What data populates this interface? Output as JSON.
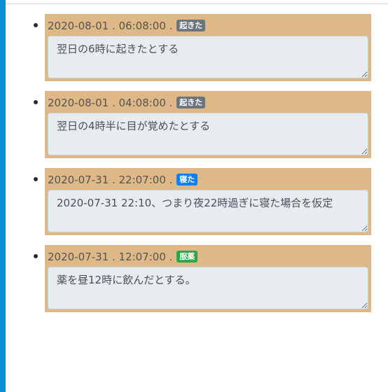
{
  "colors": {
    "frame": "#0a8fd6",
    "card_background": "#deb887"
  },
  "entries": [
    {
      "date": "2020-08-01",
      "time": "06:08:00",
      "badge": {
        "label": "起きた",
        "color": "#6c757d"
      },
      "memo": "翌日の6時に起きたとする"
    },
    {
      "date": "2020-08-01",
      "time": "04:08:00",
      "badge": {
        "label": "起きた",
        "color": "#6c757d"
      },
      "memo": "翌日の4時半に目が覚めたとする"
    },
    {
      "date": "2020-07-31",
      "time": "22:07:00",
      "badge": {
        "label": "寝た",
        "color": "#0d7ff0"
      },
      "memo": "2020-07-31 22:10、つまり夜22時過ぎに寝た場合を仮定"
    },
    {
      "date": "2020-07-31",
      "time": "12:07:00",
      "badge": {
        "label": "服薬",
        "color": "#28a745"
      },
      "memo": "薬を昼12時に飲んだとする。"
    }
  ]
}
